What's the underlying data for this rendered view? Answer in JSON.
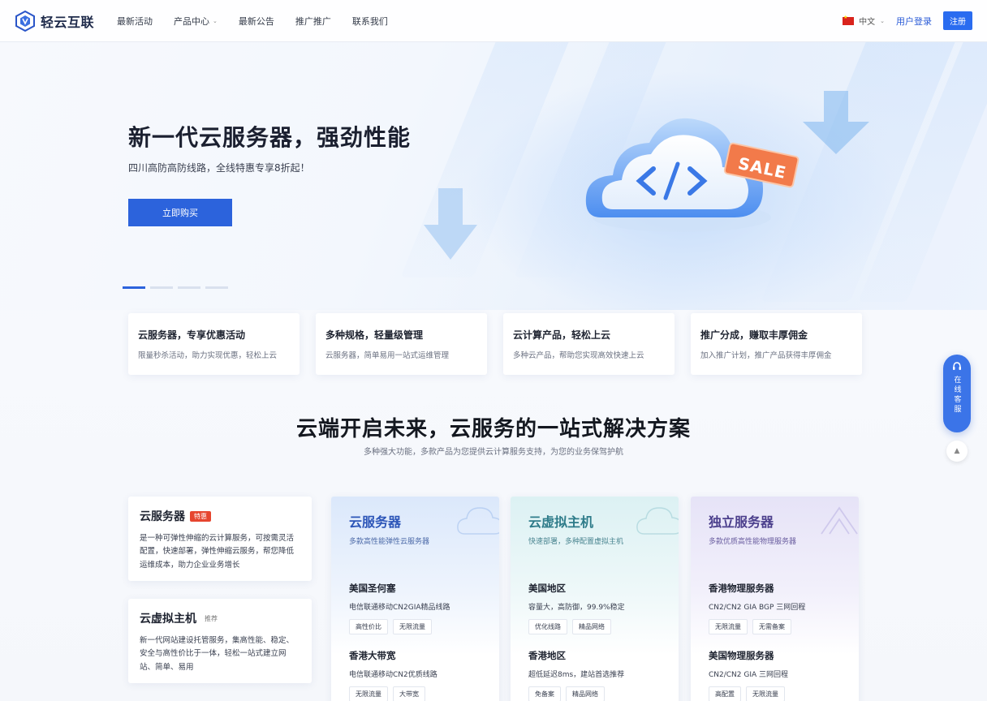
{
  "navbar": {
    "brand": "轻云互联",
    "menu": [
      {
        "label": "最新活动"
      },
      {
        "label": "产品中心",
        "has_dropdown": true
      },
      {
        "label": "最新公告"
      },
      {
        "label": "推广推广"
      },
      {
        "label": "联系我们"
      }
    ],
    "language": "中文",
    "login": "用户登录",
    "register": "注册"
  },
  "hero": {
    "title": "新一代云服务器，强劲性能",
    "subtitle": "四川高防高防线路，全线特惠专享8折起！",
    "cta": "立即购买",
    "slides": 4,
    "active_slide": 1,
    "badge": "SALE"
  },
  "features": [
    {
      "title": "云服务器，专享优惠活动",
      "desc": "限量秒杀活动，助力实现优惠，轻松上云"
    },
    {
      "title": "多种规格，轻量级管理",
      "desc": "云服务器，简单易用一站式运维管理"
    },
    {
      "title": "云计算产品，轻松上云",
      "desc": "多种云产品，帮助您实现高效快速上云"
    },
    {
      "title": "推广分成，赚取丰厚佣金",
      "desc": "加入推广计划，推广产品获得丰厚佣金"
    }
  ],
  "section": {
    "title": "云端开启未来，云服务的一站式解决方案",
    "subtitle": "多种强大功能，多款产品为您提供云计算服务支持，为您的业务保驾护航"
  },
  "product_cards": [
    {
      "title": "云服务器",
      "badge": "特惠",
      "desc": "是一种可弹性伸缩的云计算服务，可按需灵活配置，快速部署，弹性伸缩云服务，帮您降低运维成本，助力企业业务增长"
    },
    {
      "title": "云虚拟主机",
      "badge": "推荐",
      "desc": "新一代网站建设托管服务，集高性能、稳定、安全与高性价比于一体，轻松一站式建立网站、简单、易用"
    }
  ],
  "product_columns": [
    {
      "title": "云服务器",
      "subtitle": "多款高性能弹性云服务器",
      "regions": [
        {
          "title": "美国圣何塞",
          "desc": "电信联通移动CN2GIA精品线路",
          "tags": [
            "高性价比",
            "无限流量"
          ]
        },
        {
          "title": "香港大带宽",
          "desc": "电信联通移动CN2优质线路",
          "tags": [
            "无限流量",
            "大带宽"
          ]
        }
      ]
    },
    {
      "title": "云虚拟主机",
      "subtitle": "快速部署，多种配置虚拟主机",
      "regions": [
        {
          "title": "美国地区",
          "desc": "容量大，高防御，99.9%稳定",
          "tags": [
            "优化线路",
            "精品网络"
          ]
        },
        {
          "title": "香港地区",
          "desc": "超低延迟8ms，建站首选推荐",
          "tags": [
            "免备案",
            "精品网络"
          ]
        }
      ]
    },
    {
      "title": "独立服务器",
      "subtitle": "多款优质高性能物理服务器",
      "regions": [
        {
          "title": "香港物理服务器",
          "desc": "CN2/CN2 GIA BGP 三网回程",
          "tags": [
            "无限流量",
            "无需备案"
          ]
        },
        {
          "title": "美国物理服务器",
          "desc": "CN2/CN2 GIA 三网回程",
          "tags": [
            "高配置",
            "无限流量"
          ]
        }
      ]
    }
  ],
  "floating": {
    "service_label": "在线客服",
    "back_top": "▲"
  },
  "colors": {
    "primary": "#2c63dc",
    "badge_red": "#e6452f",
    "sale_orange": "#f27a4a"
  }
}
